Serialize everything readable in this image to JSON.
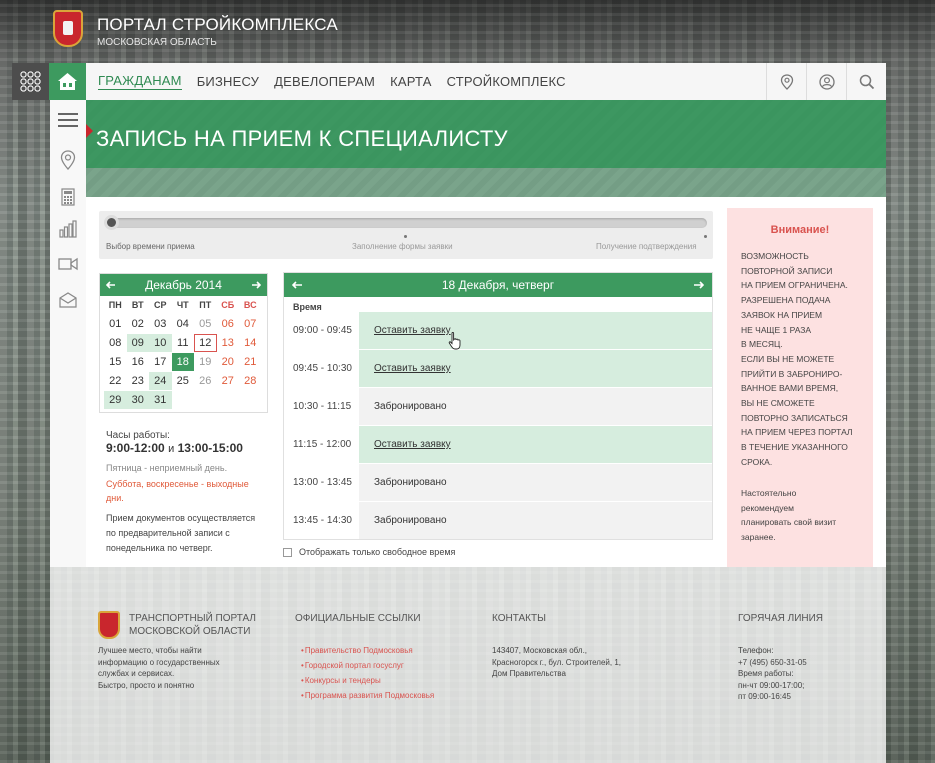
{
  "header": {
    "title": "ПОРТАЛ СТРОЙКОМПЛЕКСА",
    "subtitle": "МОСКОВСКАЯ ОБЛАСТЬ"
  },
  "nav": {
    "links": [
      "ГРАЖДАНАМ",
      "БИЗНЕСУ",
      "ДЕВЕЛОПЕРАМ",
      "КАРТА",
      "СТРОЙКОМПЛЕКС"
    ],
    "active_index": 0,
    "icons": [
      "map-pin-icon",
      "user-icon",
      "search-icon"
    ]
  },
  "banner": {
    "title": "ЗАПИСЬ НА ПРИЕМ К СПЕЦИАЛИСТУ"
  },
  "steps": {
    "labels": [
      "Выбор времени приема",
      "Заполнение формы заявки",
      "Получение подтверждения"
    ],
    "current": 0
  },
  "calendar": {
    "month": "Декабрь 2014",
    "weekdays": [
      "ПН",
      "ВТ",
      "СР",
      "ЧТ",
      "ПТ",
      "СБ",
      "ВС"
    ],
    "weeks": [
      [
        "01",
        "02",
        "03",
        "04",
        "05",
        "06",
        "07"
      ],
      [
        "08",
        "09",
        "10",
        "11",
        "12",
        "13",
        "14"
      ],
      [
        "15",
        "16",
        "17",
        "18",
        "19",
        "20",
        "21"
      ],
      [
        "22",
        "23",
        "24",
        "25",
        "26",
        "27",
        "28"
      ],
      [
        "29",
        "30",
        "31",
        "",
        "",
        "",
        ""
      ]
    ],
    "available": [
      "09",
      "10",
      "18",
      "24",
      "29",
      "30",
      "31"
    ],
    "grayed": [
      "05",
      "19",
      "26"
    ],
    "selected": "18",
    "today": "12"
  },
  "hours": {
    "label": "Часы работы:",
    "range1": "9:00-12:00",
    "and": "и",
    "range2": "13:00-15:00",
    "note_friday": "Пятница - неприемный день.",
    "note_weekend": "Суббота, воскресенье - выходные дни.",
    "note_docs": "Прием документов осуществляется по предварительной записи с понедельника по четверг."
  },
  "schedule": {
    "date": "18 Декабря, четверг",
    "col_time": "Время",
    "slots": [
      {
        "time": "09:00 - 09:45",
        "status": "free",
        "text": "Оставить заявку"
      },
      {
        "time": "09:45 - 10:30",
        "status": "free",
        "text": "Оставить заявку"
      },
      {
        "time": "10:30 - 11:15",
        "status": "busy",
        "text": "Забронировано"
      },
      {
        "time": "11:15 - 12:00",
        "status": "free",
        "text": "Оставить заявку"
      },
      {
        "time": "13:00 - 13:45",
        "status": "busy",
        "text": "Забронировано"
      },
      {
        "time": "13:45 - 14:30",
        "status": "busy",
        "text": "Забронировано"
      }
    ],
    "only_free_label": "Отображать только свободное время"
  },
  "attention": {
    "title": "Внимание!",
    "lines": [
      "ВОЗМОЖНОСТЬ",
      "ПОВТОРНОЙ ЗАПИСИ",
      "НА ПРИЕМ ОГРАНИЧЕНА.",
      "РАЗРЕШЕНА ПОДАЧА",
      "ЗАЯВОК НА ПРИЕМ",
      "НЕ ЧАЩЕ 1 РАЗА",
      "В МЕСЯЦ.",
      "ЕСЛИ ВЫ НЕ МОЖЕТЕ",
      "ПРИЙТИ В ЗАБРОНИРО-",
      "ВАННОЕ ВАМИ ВРЕМЯ,",
      "ВЫ НЕ СМОЖЕТЕ",
      "ПОВТОРНО ЗАПИСАТЬСЯ",
      "НА ПРИЕМ ЧЕРЕЗ ПОРТАЛ",
      "В ТЕЧЕНИЕ УКАЗАННОГО",
      "СРОКА."
    ],
    "recommend_lines": [
      "Настоятельно",
      "рекомендуем",
      "планировать свой визит",
      "заранее."
    ]
  },
  "footer": {
    "portal_title_line1": "ТРАНСПОРТНЫЙ ПОРТАЛ",
    "portal_title_line2": "МОСКОВСКОЙ ОБЛАСТИ",
    "portal_desc": [
      "Лучшее место, чтобы найти",
      "информацию о государственных",
      "службах и сервисах.",
      "Быстро, просто и понятно"
    ],
    "links_title": "ОФИЦИАЛЬНЫЕ ССЫЛКИ",
    "links": [
      "Правительство Подмосковья",
      "Городской портал госуслуг",
      "Конкурсы и тендеры",
      "Программа развития Подмосковья"
    ],
    "contacts_title": "КОНТАКТЫ",
    "contacts": [
      "143407, Московская обл.,",
      "Красногорск г., бул. Строителей, 1,",
      "Дом Правительства"
    ],
    "hotline_title": "ГОРЯЧАЯ ЛИНИЯ",
    "hotline": [
      "Телефон:",
      "+7 (495) 650-31-05",
      "Время работы:",
      "пн-чт 09:00-17:00;",
      "пт 09:00-16:45"
    ]
  },
  "colors": {
    "accent_green": "#3d9a5f",
    "available_green": "#d6edde",
    "alert_red": "#d9534f",
    "attention_bg": "#fde1e1"
  }
}
